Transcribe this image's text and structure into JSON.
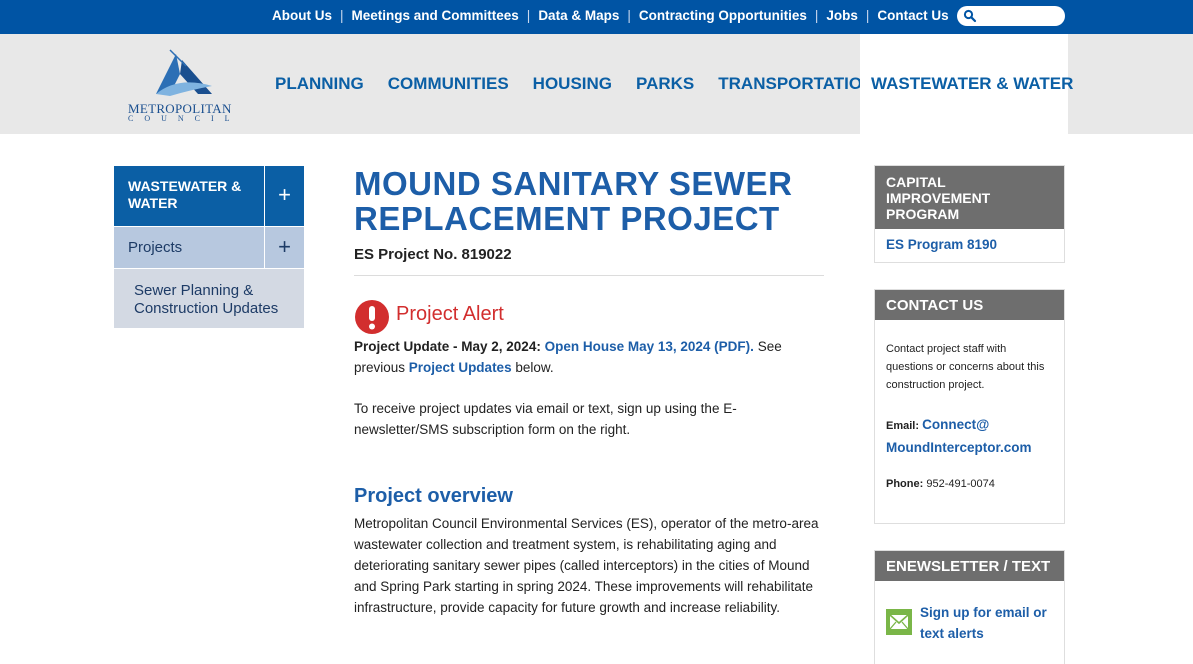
{
  "utility_nav": {
    "links": [
      "About Us",
      "Meetings and Committees",
      "Data & Maps",
      "Contracting Opportunities",
      "Jobs",
      "Contact Us"
    ],
    "search_placeholder": ""
  },
  "logo": {
    "name": "METROPOLITAN",
    "sub": "COUNCIL"
  },
  "main_nav": {
    "items": [
      "PLANNING",
      "COMMUNITIES",
      "HOUSING",
      "PARKS",
      "TRANSPORTATION"
    ],
    "active": "WASTEWATER & WATER"
  },
  "sidebar": {
    "section": "WASTEWATER & WATER",
    "projects": "Projects",
    "sub_item": "Sewer Planning & Construction Updates",
    "expand_symbol": "+"
  },
  "content": {
    "title": "MOUND SANITARY SEWER REPLACEMENT PROJECT",
    "project_no": "ES Project No. 819022",
    "alert_title": "Project Alert",
    "update_label": "Project Update - May 2, 2024:",
    "update_link": "Open House May 13, 2024 (PDF).",
    "update_see": "See previous",
    "updates_link": "Project Updates",
    "update_below": "below.",
    "signup_text": "To receive project updates via email or text, sign up using the E-newsletter/SMS subscription form on the right.",
    "overview_heading": "Project overview",
    "overview_text": "Metropolitan Council Environmental Services (ES), operator of the metro-area wastewater collection and treatment system, is rehabilitating aging and deteriorating sanitary sewer pipes (called interceptors) in the cities of Mound and Spring Park starting in spring 2024. These improvements will rehabilitate infrastructure, provide capacity for future growth and increase reliability."
  },
  "right": {
    "cip_heading": "CAPITAL IMPROVEMENT PROGRAM",
    "cip_link": "ES Program 8190",
    "contact_heading": "CONTACT US",
    "contact_text": "Contact project staff with questions or concerns about this construction project.",
    "email_label": "Email:",
    "email_link": "Connect@ MoundInterceptor.com",
    "phone_label": "Phone:",
    "phone_value": "952-491-0074",
    "enews_heading": "ENEWSLETTER / TEXT",
    "enews_link": "Sign up for email or text alerts"
  },
  "colors": {
    "top_bar": "#0054a4",
    "link_blue": "#1d5ea8",
    "alert_red": "#d22e2e",
    "box_header": "#6e6e6e"
  }
}
